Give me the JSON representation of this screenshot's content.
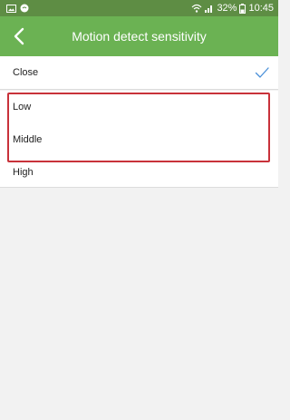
{
  "status_bar": {
    "battery": "32%",
    "time": "10:45",
    "icons": [
      "image-icon",
      "chat-icon",
      "wifi-icon",
      "signal-icon",
      "battery-icon"
    ]
  },
  "header": {
    "title": "Motion detect sensitivity",
    "back_icon": "chevron-left-icon",
    "background": "#6bb253"
  },
  "options": [
    {
      "label": "Close",
      "selected": true
    },
    {
      "label": "Low",
      "selected": false
    },
    {
      "label": "Middle",
      "selected": false
    },
    {
      "label": "High",
      "selected": false
    }
  ],
  "colors": {
    "accent": "#6bb253",
    "status_bar": "#5e8d44",
    "check": "#4a90d9",
    "highlight": "#c8323a",
    "background": "#f2f2f2"
  }
}
